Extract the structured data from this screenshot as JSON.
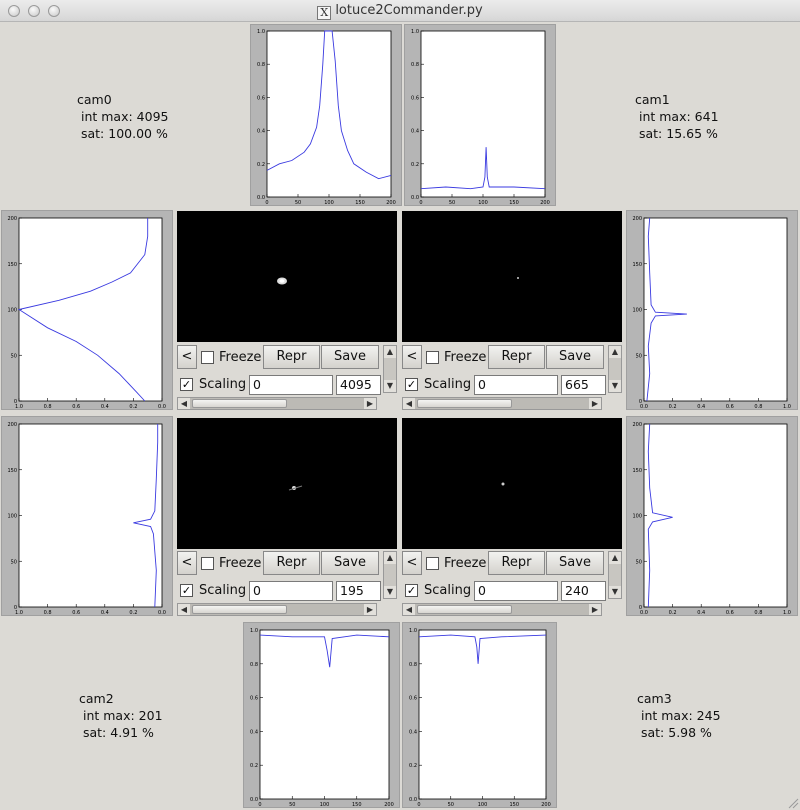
{
  "window": {
    "title": "lotuce2Commander.py",
    "icon": "x11-icon"
  },
  "cameras": [
    {
      "name": "cam0",
      "int_max_text": "int max: 4095",
      "sat_text": "sat: 100.00 %",
      "scale_min": "0",
      "scale_max": "4095",
      "scaling_checked": true,
      "freeze_checked": false
    },
    {
      "name": "cam1",
      "int_max_text": "int max: 641",
      "sat_text": "sat: 15.65 %",
      "scale_min": "0",
      "scale_max": "665",
      "scaling_checked": true,
      "freeze_checked": false
    },
    {
      "name": "cam2",
      "int_max_text": "int max: 201",
      "sat_text": "sat: 4.91 %",
      "scale_min": "0",
      "scale_max": "195",
      "scaling_checked": true,
      "freeze_checked": false
    },
    {
      "name": "cam3",
      "int_max_text": "int max: 245",
      "sat_text": "sat: 5.98 %",
      "scale_min": "0",
      "scale_max": "240",
      "scaling_checked": true,
      "freeze_checked": false
    }
  ],
  "controls": {
    "back_label": "<",
    "freeze_label": "Freeze",
    "repr_label": "Repr",
    "save_label": "Save",
    "scaling_label": "Scaling",
    "check_mark": "✓"
  },
  "icons": {
    "scroll_up": "▲",
    "scroll_down": "▼",
    "scroll_left": "◀",
    "scroll_right": "▶"
  },
  "colors": {
    "trace": "#3a3ae0",
    "panel_bg": "#dcdad5",
    "image_bg": "#000000"
  },
  "chart_data": [
    {
      "type": "line",
      "orientation": "horizontal",
      "camera": "cam0",
      "x_ticks": [
        "0",
        "50",
        "100",
        "150",
        "200"
      ],
      "y_ticks": [
        "0.0",
        "0.2",
        "0.4",
        "0.6",
        "0.8",
        "1.0"
      ],
      "xlim": [
        0,
        200
      ],
      "ylim": [
        0,
        1
      ],
      "x": [
        0,
        20,
        40,
        60,
        70,
        80,
        85,
        90,
        93,
        95,
        100,
        105,
        110,
        115,
        120,
        130,
        140,
        160,
        180,
        200
      ],
      "y": [
        0.16,
        0.2,
        0.22,
        0.27,
        0.32,
        0.42,
        0.55,
        0.8,
        1.0,
        1.0,
        1.0,
        1.0,
        0.82,
        0.55,
        0.4,
        0.28,
        0.2,
        0.15,
        0.11,
        0.13
      ]
    },
    {
      "type": "line",
      "orientation": "horizontal",
      "camera": "cam1",
      "x_ticks": [
        "0",
        "50",
        "100",
        "150",
        "200"
      ],
      "y_ticks": [
        "0.0",
        "0.2",
        "0.4",
        "0.6",
        "0.8",
        "1.0"
      ],
      "xlim": [
        0,
        200
      ],
      "ylim": [
        0,
        1
      ],
      "x": [
        0,
        40,
        80,
        100,
        103,
        105,
        107,
        110,
        150,
        200
      ],
      "y": [
        0.05,
        0.06,
        0.05,
        0.06,
        0.12,
        0.3,
        0.12,
        0.06,
        0.06,
        0.05
      ]
    },
    {
      "type": "line",
      "orientation": "vertical",
      "camera": "cam0",
      "x_ticks": [
        "1.0",
        "0.8",
        "0.6",
        "0.4",
        "0.2",
        "0.0"
      ],
      "y_ticks": [
        "0",
        "50",
        "100",
        "150",
        "200"
      ],
      "xlim": [
        1,
        0
      ],
      "ylim": [
        0,
        200
      ],
      "x": [
        0.12,
        0.18,
        0.3,
        0.45,
        0.6,
        0.8,
        1.0,
        0.72,
        0.5,
        0.35,
        0.22,
        0.12,
        0.1,
        0.1
      ],
      "y": [
        0,
        10,
        30,
        50,
        65,
        80,
        100,
        110,
        120,
        130,
        140,
        160,
        180,
        200
      ]
    },
    {
      "type": "line",
      "orientation": "vertical",
      "camera": "cam1",
      "x_ticks": [
        "0.0",
        "0.2",
        "0.4",
        "0.6",
        "0.8",
        "1.0"
      ],
      "y_ticks": [
        "0",
        "50",
        "100",
        "150",
        "200"
      ],
      "xlim": [
        0,
        1
      ],
      "ylim": [
        0,
        200
      ],
      "x": [
        0.02,
        0.04,
        0.03,
        0.05,
        0.08,
        0.3,
        0.08,
        0.05,
        0.04,
        0.03,
        0.04
      ],
      "y": [
        0,
        30,
        60,
        85,
        93,
        95,
        97,
        105,
        140,
        180,
        200
      ]
    },
    {
      "type": "line",
      "orientation": "vertical",
      "camera": "cam2",
      "x_ticks": [
        "1.0",
        "0.8",
        "0.6",
        "0.4",
        "0.2",
        "0.0"
      ],
      "y_ticks": [
        "0",
        "50",
        "100",
        "150",
        "200"
      ],
      "xlim": [
        1,
        0
      ],
      "ylim": [
        0,
        200
      ],
      "x": [
        0.05,
        0.04,
        0.06,
        0.08,
        0.2,
        0.08,
        0.05,
        0.04,
        0.03,
        0.03
      ],
      "y": [
        0,
        40,
        80,
        88,
        92,
        96,
        105,
        140,
        180,
        200
      ]
    },
    {
      "type": "line",
      "orientation": "vertical",
      "camera": "cam3",
      "x_ticks": [
        "0.0",
        "0.2",
        "0.4",
        "0.6",
        "0.8",
        "1.0"
      ],
      "y_ticks": [
        "0",
        "50",
        "100",
        "150",
        "200"
      ],
      "xlim": [
        0,
        1
      ],
      "ylim": [
        0,
        200
      ],
      "x": [
        0.03,
        0.04,
        0.03,
        0.06,
        0.2,
        0.06,
        0.04,
        0.03,
        0.04
      ],
      "y": [
        0,
        40,
        85,
        93,
        98,
        103,
        130,
        170,
        200
      ]
    },
    {
      "type": "line",
      "orientation": "horizontal-inverted",
      "camera": "cam2",
      "x_ticks": [
        "0",
        "50",
        "100",
        "150",
        "200"
      ],
      "y_ticks": [
        "0.0",
        "0.2",
        "0.4",
        "0.6",
        "0.8",
        "1.0"
      ],
      "xlim": [
        0,
        200
      ],
      "ylim": [
        1,
        0
      ],
      "x": [
        0,
        50,
        100,
        104,
        108,
        112,
        150,
        200
      ],
      "y": [
        0.03,
        0.04,
        0.04,
        0.12,
        0.22,
        0.05,
        0.03,
        0.04
      ]
    },
    {
      "type": "line",
      "orientation": "horizontal-inverted",
      "camera": "cam3",
      "x_ticks": [
        "0",
        "50",
        "100",
        "150",
        "200"
      ],
      "y_ticks": [
        "0.0",
        "0.2",
        "0.4",
        "0.6",
        "0.8",
        "1.0"
      ],
      "xlim": [
        0,
        200
      ],
      "ylim": [
        1,
        0
      ],
      "x": [
        0,
        50,
        88,
        91,
        93,
        96,
        130,
        200
      ],
      "y": [
        0.04,
        0.03,
        0.04,
        0.1,
        0.2,
        0.05,
        0.04,
        0.03
      ]
    }
  ]
}
